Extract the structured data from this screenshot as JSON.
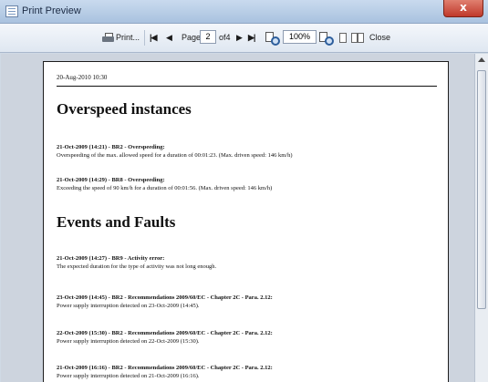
{
  "window": {
    "title": "Print Preview",
    "close_glyph": "x"
  },
  "toolbar": {
    "print_label": "Print...",
    "first_glyph": "|◀",
    "prev_glyph": "◀",
    "page_label": "Page",
    "page_value": "2",
    "of_label": "of4",
    "next_glyph": "▶",
    "last_glyph": "▶|",
    "zoom_value": "100%",
    "close_label": "Close"
  },
  "document": {
    "date": "20-Aug-2010 10:30",
    "sections": [
      {
        "heading": "Overspeed instances",
        "entries": [
          {
            "title": "21-Oct-2009 (14:21) - BR2 - Overspeeding:",
            "text": "Overspeeding of the max. allowed speed for a duration of 00:01:23. (Max. driven speed: 146 km/h)"
          },
          {
            "title": "21-Oct-2009 (14:29) - BR8 - Overspeeding:",
            "text": "Exceeding the speed of 90 km/h for a duration of 00:01:56. (Max. driven speed: 146 km/h)"
          }
        ]
      },
      {
        "heading": "Events and Faults",
        "entries": [
          {
            "title": "21-Oct-2009 (14:27) - BR9 - Activity error:",
            "text": "The expected duration for the type of activity was not long enough."
          },
          {
            "title": "23-Oct-2009 (14:45) - BR2 - Recommendations 2009/60/EC - Chapter 2C - Para. 2.12:",
            "text": "Power supply interruption detected on 23-Oct-2009 (14:45)."
          },
          {
            "title": "22-Oct-2009 (15:30) - BR2 - Recommendations 2009/60/EC - Chapter 2C - Para. 2.12:",
            "text": "Power supply interruption detected on 22-Oct-2009 (15:30)."
          },
          {
            "title": "21-Oct-2009 (16:16) - BR2 - Recommendations 2009/60/EC - Chapter 2C - Para. 2.12:",
            "text": "Power supply interruption detected on 21-Oct-2009 (16:16)."
          }
        ]
      }
    ]
  }
}
